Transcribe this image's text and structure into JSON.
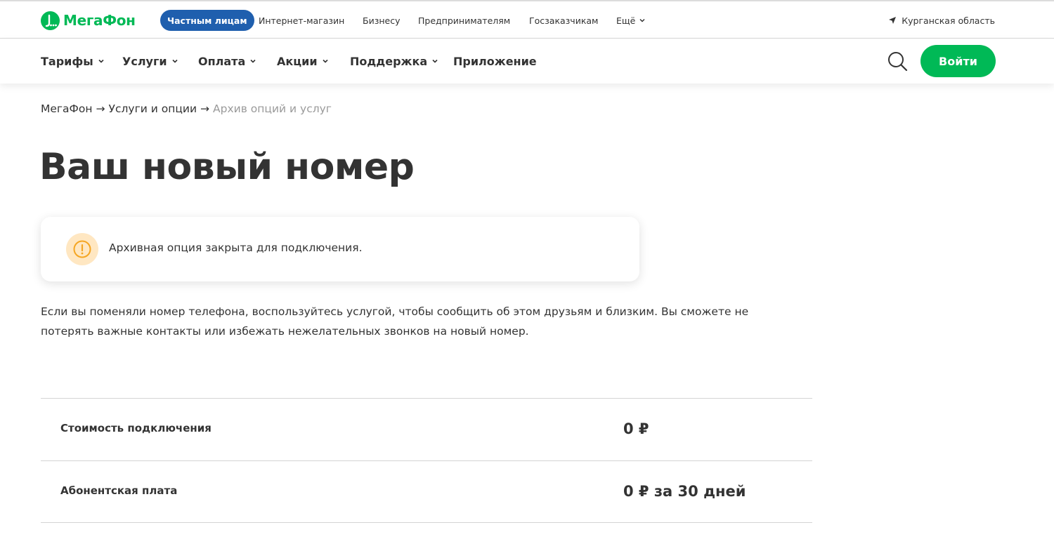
{
  "header": {
    "logo_text": "МегаФон",
    "segments": {
      "private": "Частным лицам",
      "shop": "Интернет-магазин",
      "business": "Бизнесу",
      "entrepreneurs": "Предпринимателям",
      "government": "Госзаказчикам",
      "more": "Ещё"
    },
    "region": "Курганская область"
  },
  "nav": {
    "items": [
      "Тарифы",
      "Услуги",
      "Оплата",
      "Акции",
      "Поддержка",
      "Приложение"
    ],
    "login_label": "Войти"
  },
  "breadcrumb": {
    "home": "МегаФон",
    "section": "Услуги и опции",
    "current": "Архив опций и услуг",
    "separator": "→"
  },
  "page": {
    "title": "Ваш новый номер",
    "notice": "Архивная опция закрыта для подключения.",
    "description": "Если вы поменяли номер телефона, воспользуйтесь услугой, чтобы сообщить об этом друзьям и близким. Вы сможете не потерять важные контакты или избежать нежелательных звонков на новый номер."
  },
  "prices": [
    {
      "label": "Стоимость подключения",
      "value": "0 ₽"
    },
    {
      "label": "Абонентская плата",
      "value": "0 ₽ за 30 дней"
    }
  ],
  "colors": {
    "brand_green": "#00b956",
    "segment_active": "#1f5fae",
    "warning_icon": "#f5a623",
    "warning_bg": "#ffe7c2"
  }
}
